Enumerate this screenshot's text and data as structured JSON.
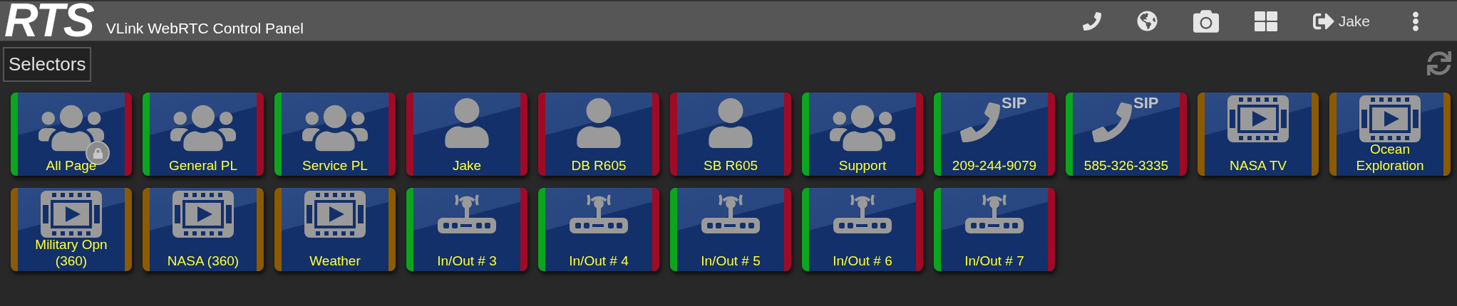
{
  "header": {
    "logo": "RTS",
    "title": "VLink WebRTC Control Panel",
    "user": "Jake"
  },
  "section": {
    "title": "Selectors"
  },
  "tiles": [
    {
      "label": "All Page",
      "kind": "group",
      "locked": true,
      "left": {
        "color": "#0ba51e"
      },
      "right": {
        "color": "#a10a25"
      }
    },
    {
      "label": "General PL",
      "kind": "group",
      "locked": false,
      "left": {
        "color": "#0ba51e"
      },
      "right": {
        "color": "#a10a25"
      }
    },
    {
      "label": "Service PL",
      "kind": "group",
      "locked": false,
      "left": {
        "color": "#0ba51e"
      },
      "right": {
        "color": "#a10a25"
      }
    },
    {
      "label": "Jake",
      "kind": "person",
      "locked": false,
      "left": {
        "color": "#a10a25"
      },
      "right": {
        "color": "#a10a25"
      }
    },
    {
      "label": "DB R605",
      "kind": "person",
      "locked": false,
      "left": {
        "color": "#a10a25"
      },
      "right": {
        "color": "#a10a25"
      }
    },
    {
      "label": "SB R605",
      "kind": "person",
      "locked": false,
      "left": {
        "color": "#a10a25"
      },
      "right": {
        "color": "#a10a25"
      }
    },
    {
      "label": "Support",
      "kind": "group",
      "locked": false,
      "left": {
        "color": "#0ba51e"
      },
      "right": {
        "color": "#a10a25"
      }
    },
    {
      "label": "209-244-9079",
      "kind": "sip",
      "icon_text": "SIP",
      "locked": false,
      "left": {
        "color": "#0ba51e"
      },
      "right": {
        "color": "#a10a25"
      }
    },
    {
      "label": "585-326-3335",
      "kind": "sip",
      "icon_text": "SIP",
      "locked": false,
      "left": {
        "color": "#0ba51e"
      },
      "right": {
        "color": "#a10a25"
      }
    },
    {
      "label": "NASA TV",
      "kind": "film",
      "locked": false,
      "left": {
        "color": "#8c5a00"
      },
      "right": {
        "color": "#8c5a00"
      }
    },
    {
      "label": "Ocean Exploration",
      "kind": "film",
      "locked": false,
      "left": {
        "color": "#8c5a00"
      },
      "right": {
        "color": "#8c5a00"
      }
    },
    {
      "label": "Military Opn (360)",
      "kind": "film",
      "locked": false,
      "left": {
        "color": "#8c5a00"
      },
      "right": {
        "color": "#8c5a00"
      }
    },
    {
      "label": "NASA (360)",
      "kind": "film",
      "locked": false,
      "left": {
        "color": "#8c5a00"
      },
      "right": {
        "color": "#8c5a00"
      }
    },
    {
      "label": "Weather",
      "kind": "film",
      "locked": false,
      "left": {
        "color": "#8c5a00"
      },
      "right": {
        "color": "#8c5a00"
      }
    },
    {
      "label": "In/Out # 3",
      "kind": "router",
      "locked": false,
      "left": {
        "color": "#0ba51e"
      },
      "right": {
        "color": "#a10a25"
      }
    },
    {
      "label": "In/Out # 4",
      "kind": "router",
      "locked": false,
      "left": {
        "color": "#0ba51e"
      },
      "right": {
        "color": "#a10a25"
      }
    },
    {
      "label": "In/Out # 5",
      "kind": "router",
      "locked": false,
      "left": {
        "color": "#0ba51e"
      },
      "right": {
        "color": "#a10a25"
      }
    },
    {
      "label": "In/Out # 6",
      "kind": "router",
      "locked": false,
      "left": {
        "color": "#0ba51e"
      },
      "right": {
        "color": "#a10a25"
      }
    },
    {
      "label": "In/Out # 7",
      "kind": "router",
      "locked": false,
      "left": {
        "color": "#0ba51e"
      },
      "right": {
        "color": "#a10a25"
      }
    }
  ]
}
